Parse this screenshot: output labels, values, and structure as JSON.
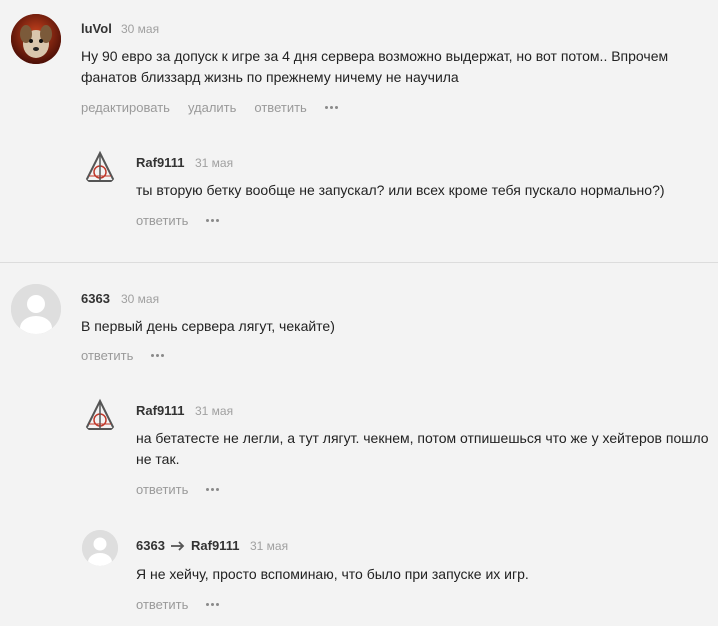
{
  "comments": [
    {
      "author": "luVol",
      "date": "30 мая",
      "text": "Ну 90 евро за допуск к игре за 4 дня сервера возможно выдержат, но вот потом.. Впрочем фанатов близзард жизнь по прежнему ничему не научила",
      "actions": [
        "редактировать",
        "удалить",
        "ответить"
      ]
    },
    {
      "author": "Raf9111",
      "date": "31 мая",
      "text": "ты вторую бетку вообще не запускал? или всех кроме тебя пускало нормально?)",
      "actions": [
        "ответить"
      ]
    },
    {
      "author": "6363",
      "date": "30 мая",
      "text": "В первый день сервера лягут, чекайте)",
      "actions": [
        "ответить"
      ]
    },
    {
      "author": "Raf9111",
      "date": "31 мая",
      "text": "на бетатесте не легли, а тут лягут. чекнем, потом отпишешься что же у хейтеров пошло не так.",
      "actions": [
        "ответить"
      ]
    },
    {
      "author": "6363",
      "reply_to": "Raf9111",
      "date": "31 мая",
      "text": "Я не хейчу, просто вспоминаю, что было при запуске их игр.",
      "actions": [
        "ответить"
      ]
    }
  ],
  "colors": {
    "background": "#f3f3f3",
    "action_text": "#9a9a9a",
    "date_text": "#a0a0a0"
  }
}
